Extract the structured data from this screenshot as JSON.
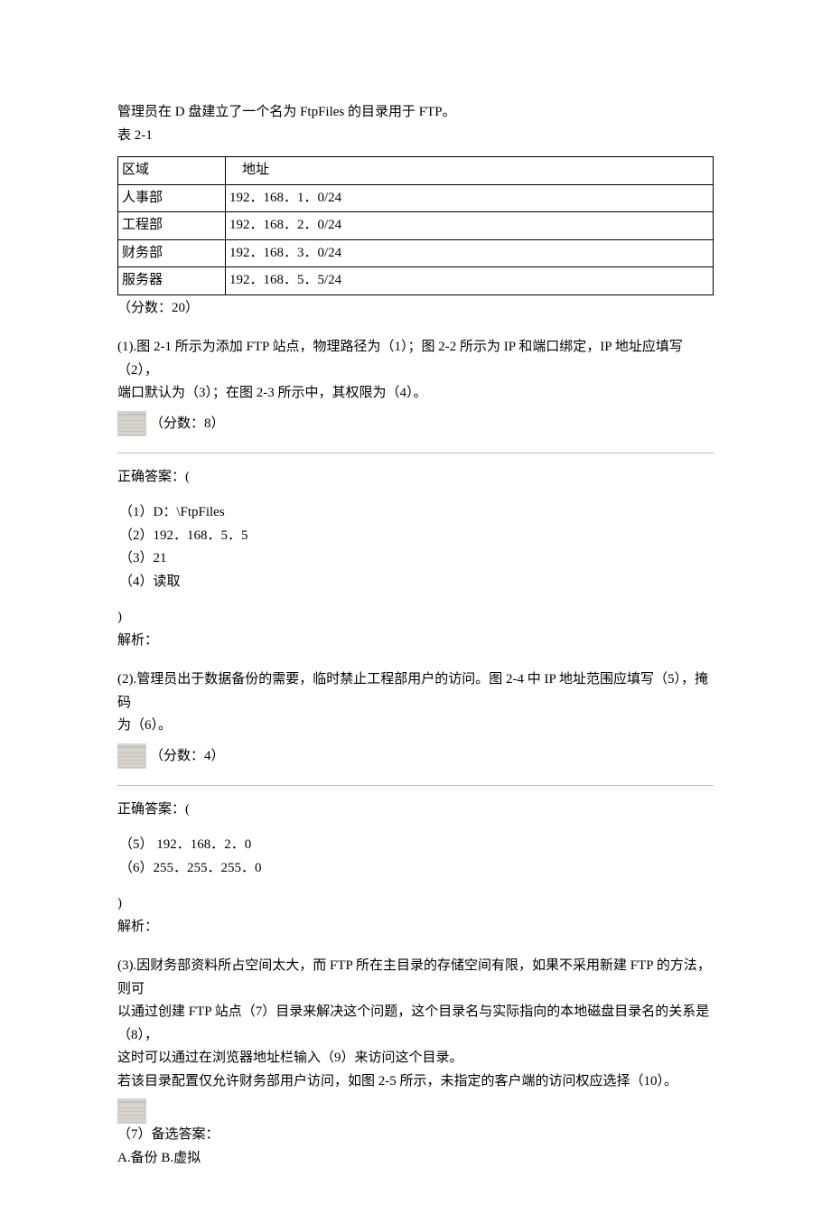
{
  "intro": {
    "line1": "管理员在 D 盘建立了一个名为 FtpFiles 的目录用于 FTP。",
    "line2": "表 2-1"
  },
  "table": {
    "headers": [
      "区域",
      "地址"
    ],
    "rows": [
      [
        "人事部",
        "192．168．1．0/24"
      ],
      [
        "工程部",
        "192．168．2．0/24"
      ],
      [
        "财务部",
        "192．168．3．0/24"
      ],
      [
        "服务器",
        "192．168．5．5/24"
      ]
    ]
  },
  "score_main": "（分数：20）",
  "q1": {
    "text_line1": "(1).图 2-1 所示为添加 FTP 站点，物理路径为（1）；图 2-2 所示为 IP 和端口绑定，IP 地址应填写（2），",
    "text_line2": "端口默认为（3）；在图 2-3 所示中，其权限为（4）。",
    "score": "（分数：8）",
    "answer_label": "正确答案：(",
    "answers": [
      "（1）D：\\FtpFiles",
      "（2）192．168．5．5",
      "（3）21",
      "（4）读取"
    ],
    "close": ")",
    "analysis": "解析："
  },
  "q2": {
    "text_line1": "(2).管理员出于数据备份的需要，临时禁止工程部用户的访问。图 2-4 中 IP 地址范围应填写（5），掩码",
    "text_line2": "为（6）。",
    "score": "（分数：4）",
    "answer_label": "正确答案：(",
    "answers": [
      "（5）  192．168．2．0",
      "（6）255．255．255．0"
    ],
    "close": ")",
    "analysis": "解析："
  },
  "q3": {
    "text_line1": "(3).因财务部资料所占空间太大，而 FTP 所在主目录的存储空间有限，如果不采用新建 FTP 的方法，则可",
    "text_line2": "以通过创建 FTP 站点（7）目录来解决这个问题，这个目录名与实际指向的本地磁盘目录名的关系是（8），",
    "text_line3": "这时可以通过在浏览器地址栏输入（9）来访问这个目录。",
    "text_line4": "若该目录配置仅允许财务部用户访问，如图 2-5 所示，未指定的客户端的访问权应选择（10）。",
    "opt_label": "（7）备选答案：",
    "options": "A.备份  B.虚拟"
  }
}
